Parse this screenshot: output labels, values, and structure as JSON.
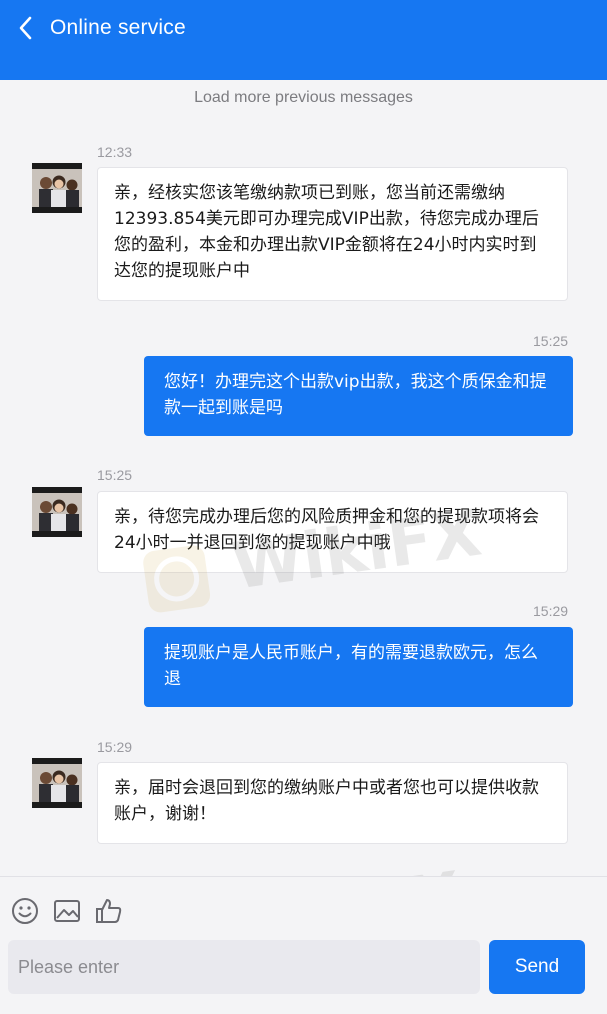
{
  "header": {
    "title": "Online service",
    "back_icon": "chevron-left-icon"
  },
  "chat": {
    "load_more": "Load more previous messages",
    "messages": [
      {
        "direction": "incoming",
        "time": "12:33",
        "text": "亲，经核实您该笔缴纳款项已到账，您当前还需缴纳12393.854美元即可办理完成VIP出款，待您完成办理后您的盈利，本金和办理出款VIP金额将在24小时内实时到达您的提现账户中"
      },
      {
        "direction": "outgoing",
        "time": "15:25",
        "text": "您好！办理完这个出款vip出款，我这个质保金和提款一起到账是吗"
      },
      {
        "direction": "incoming",
        "time": "15:25",
        "text": "亲，待您完成办理后您的风险质押金和您的提现款项将会24小时一并退回到您的提现账户中哦"
      },
      {
        "direction": "outgoing",
        "time": "15:29",
        "text": "提现账户是人民币账户，有的需要退款欧元，怎么退"
      },
      {
        "direction": "incoming",
        "time": "15:29",
        "text": "亲，届时会退回到您的缴纳账户中或者您也可以提供收款账户，谢谢！"
      }
    ]
  },
  "composer": {
    "placeholder": "Please enter",
    "value": "",
    "send_label": "Send",
    "tools": [
      "emoji-icon",
      "image-icon",
      "thumbs-up-icon"
    ]
  },
  "watermark": "WikiFX",
  "colors": {
    "accent": "#1677f2",
    "background": "#f4f4f6",
    "incoming_bubble": "#ffffff"
  }
}
